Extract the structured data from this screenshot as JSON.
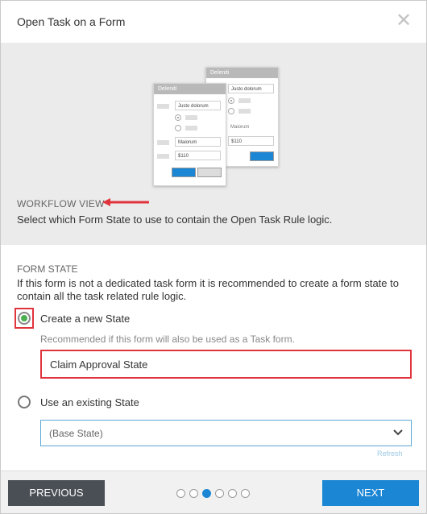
{
  "dialog": {
    "title": "Open Task on a Form"
  },
  "illustration": {
    "back_card": {
      "header": "Deleniti",
      "field1": "Justo dolorum",
      "label": "Maiorum",
      "field2": "$110"
    },
    "front_card": {
      "header": "Deleniti",
      "field1": "Justo dolorum",
      "field2": "Maiorum",
      "field3": "$110"
    }
  },
  "workflow": {
    "title": "WORKFLOW VIEW",
    "description": "Select which Form State to use to contain the Open Task Rule logic."
  },
  "form_state": {
    "title": "FORM STATE",
    "description": "If this form is not a dedicated task form it is recommended to create a form state to contain all the task related rule logic.",
    "option_new": {
      "label": "Create a new State",
      "hint": "Recommended if this form will also be used as a Task form.",
      "value": "Claim Approval State",
      "selected": true
    },
    "option_existing": {
      "label": "Use an existing State",
      "value": "(Base State)",
      "selected": false
    },
    "faint_link": "Refresh"
  },
  "footer": {
    "previous_label": "PREVIOUS",
    "next_label": "NEXT",
    "steps_total": 6,
    "current_step": 3
  },
  "colors": {
    "accent": "#1b86d4",
    "highlight": "#e0343c",
    "radio_selected": "#4caf50"
  }
}
